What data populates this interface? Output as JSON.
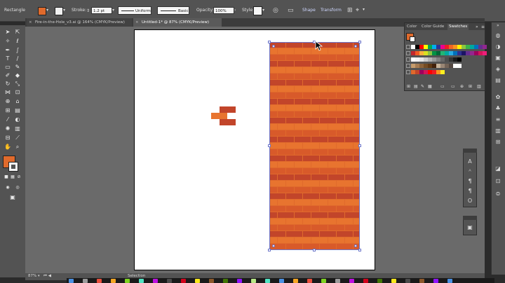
{
  "control_bar": {
    "selection_type": "Rectangle",
    "stroke_label": "Stroke:",
    "stroke_weight": "1.2 pt",
    "profile_value": "Uniform",
    "brush_value": "Basic",
    "opacity_label": "Opacity:",
    "opacity_value": "100%",
    "style_label": "Style:",
    "shape_label": "Shape",
    "transform_label": "Transform",
    "fill_color": "#e06a2c"
  },
  "tabs": [
    {
      "label": "Fire-in-the-Hole_v3.ai @ 164% (CMYK/Preview)",
      "active": false
    },
    {
      "label": "Untitled-1* @ 87% (CMYK/Preview)",
      "active": true
    }
  ],
  "panel": {
    "tabs": [
      "Color",
      "Color Guide",
      "Swatches"
    ],
    "active_tab": "Swatches"
  },
  "status_bar": {
    "zoom": "87%",
    "tool": "Selection"
  },
  "colors": {
    "brick_light": "#e8742f",
    "brick_dark": "#c2452a",
    "brick_mid": "#d85a2a",
    "selection_blue": "#6b74c9"
  }
}
